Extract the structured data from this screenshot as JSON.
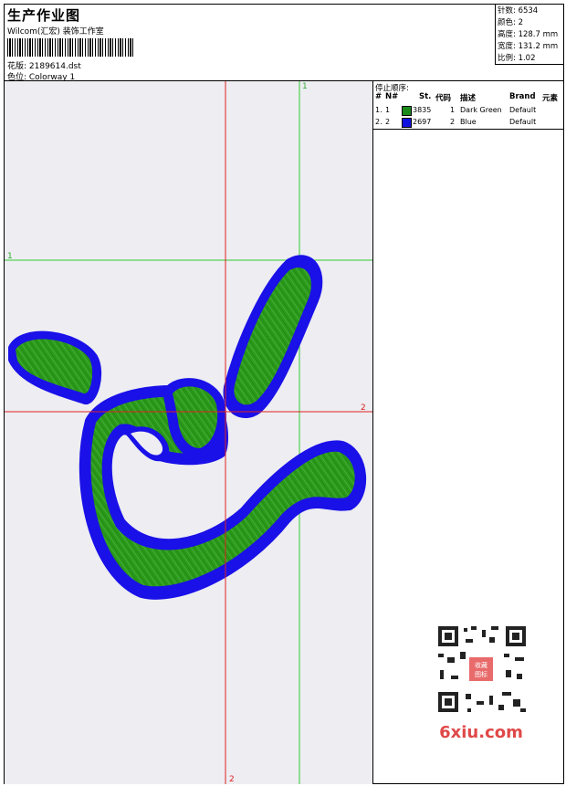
{
  "header": {
    "title": "生产作业图",
    "subtitle": "Wilcom(汇宏) 装饰工作室",
    "design_label": "花版: 2189614.dst",
    "colorway_label": "色位: Colorway 1"
  },
  "stats": [
    "针数: 6534",
    "颜色: 2",
    "高度: 128.7 mm",
    "宽度: 131.2 mm",
    "比例: 1.02"
  ],
  "stop_table": {
    "title": "停止顺序:",
    "headers": {
      "num": "#",
      "n": "N#",
      "st": "St.",
      "code": "代码",
      "desc": "描述",
      "brand": "Brand",
      "element": "元素"
    },
    "rows": [
      {
        "num": "1.",
        "n": "1",
        "color": "#1a8a1a",
        "st": "3835",
        "code": "1",
        "desc": "Dark Green",
        "brand": "Default"
      },
      {
        "num": "2.",
        "n": "2",
        "color": "#1010e0",
        "st": "2697",
        "code": "2",
        "desc": "Blue",
        "brand": "Default"
      }
    ]
  },
  "guides": {
    "green_h": "1",
    "green_v": "1",
    "red_h": "2",
    "red_v": "2"
  },
  "watermark": {
    "text": "6xiu.com",
    "stamp": "收藏图标"
  },
  "colors": {
    "thread_green": "#2a9a1a",
    "thread_blue": "#1a10e8",
    "guide_green": "#33cc33",
    "guide_red": "#dd2222",
    "canvas": "#ededf2"
  }
}
